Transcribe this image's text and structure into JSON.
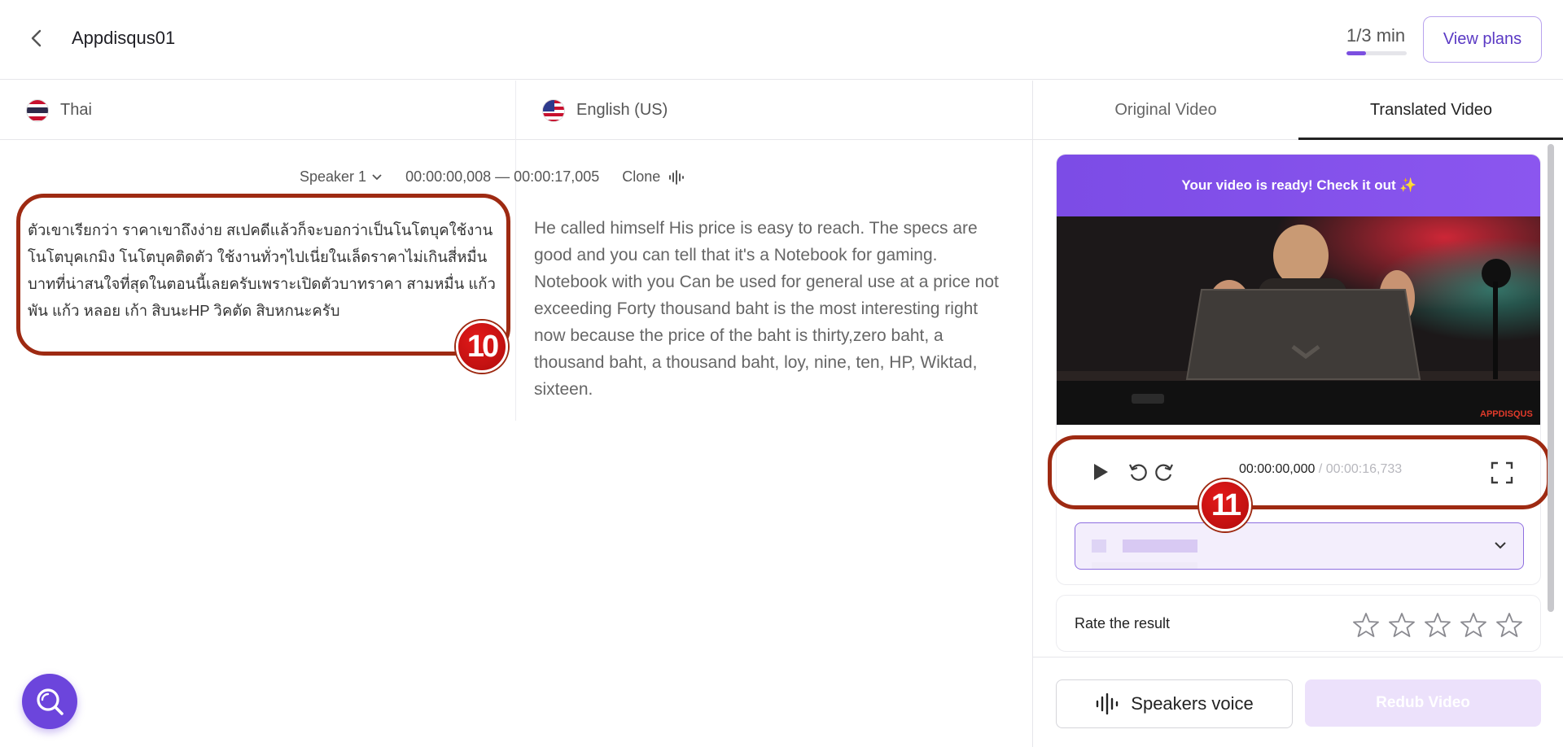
{
  "header": {
    "project_title": "Appdisqus01",
    "usage_text": "1/3 min",
    "usage_fraction": 0.33,
    "view_plans_label": "View plans"
  },
  "languages": {
    "source": {
      "label": "Thai",
      "flag": "thai-flag-icon"
    },
    "target": {
      "label": "English (US)",
      "flag": "us-flag-icon"
    }
  },
  "segment": {
    "speaker": "Speaker 1",
    "time_range": "00:00:00,008 — 00:00:17,005",
    "clone_label": "Clone",
    "source_text": "ตัวเขาเรียกว่า ราคาเขาถึงง่าย สเปคดีแล้วก็จะบอกว่าเป็นโนโตบุคใช้งานโนโตบุคเกมิง โนโตบุคติดตัว ใช้งานทั่วๆไปเนี่ยในเล็ดราคาไม่เกินสี่หมื่นบาทที่น่าสนใจที่สุดในตอนนี้เลยครับเพราะเปิดตัวบาทราคา สามหมื่น แก้ว พัน แก้ว หลอย เก้า สิบนะHP วิคตัด สิบหกนะครับ",
    "target_text": "He called himself His price is easy to reach. The specs are good and you can tell that it's a Notebook for gaming. Notebook with you Can be used for general use at a price not exceeding Forty thousand baht is the most interesting right now because the price of the baht is thirty,zero baht, a thousand baht, a thousand baht, loy, nine, ten, HP, Wiktad, sixteen."
  },
  "annotations": {
    "badge_10": "10",
    "badge_11": "11"
  },
  "right_pane": {
    "tabs": [
      {
        "label": "Original Video"
      },
      {
        "label": "Translated Video"
      }
    ],
    "active_tab": "Translated Video",
    "banner": "Your video is ready!  Check it out ✨",
    "video_watermark": "APPDISQUS",
    "player": {
      "current_time": "00:00:00,000",
      "total_time": " / 00:00:16,733"
    },
    "rate_label": "Rate the result",
    "speakers_voice_label": "Speakers voice",
    "redub_label": "Redub Video"
  },
  "colors": {
    "accent": "#7b4fe0",
    "annotation": "#9e2a12",
    "badge": "#d01414",
    "redub_disabled_bg": "#ece1fb"
  }
}
